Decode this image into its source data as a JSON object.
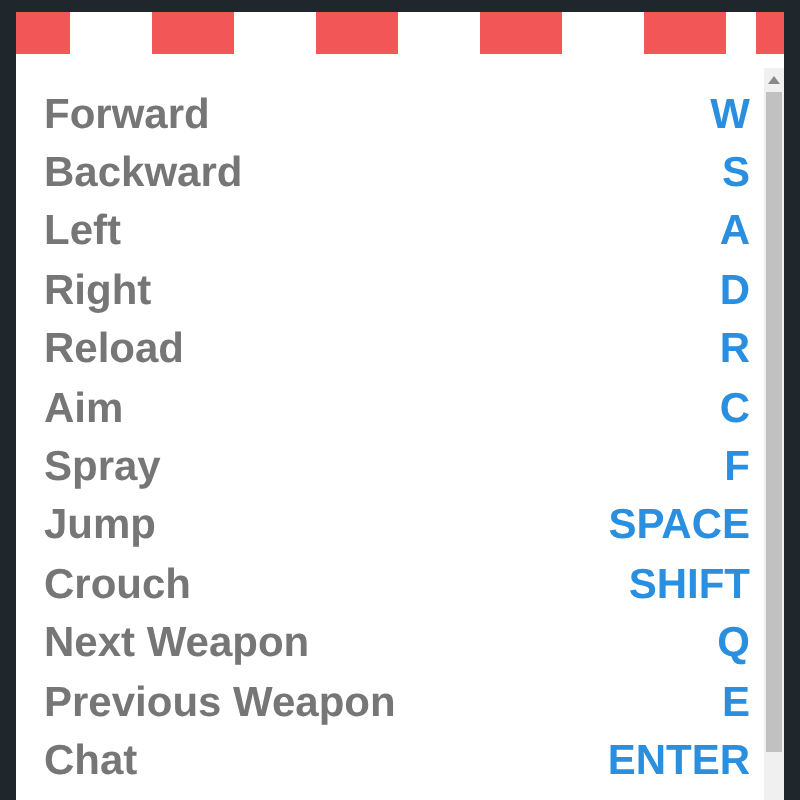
{
  "bindings": [
    {
      "action": "Forward",
      "key": "W"
    },
    {
      "action": "Backward",
      "key": "S"
    },
    {
      "action": "Left",
      "key": "A"
    },
    {
      "action": "Right",
      "key": "D"
    },
    {
      "action": "Reload",
      "key": "R"
    },
    {
      "action": "Aim",
      "key": "C"
    },
    {
      "action": "Spray",
      "key": "F"
    },
    {
      "action": "Jump",
      "key": "SPACE"
    },
    {
      "action": "Crouch",
      "key": "SHIFT"
    },
    {
      "action": "Next Weapon",
      "key": "Q"
    },
    {
      "action": "Previous Weapon",
      "key": "E"
    },
    {
      "action": "Chat",
      "key": "ENTER"
    }
  ]
}
